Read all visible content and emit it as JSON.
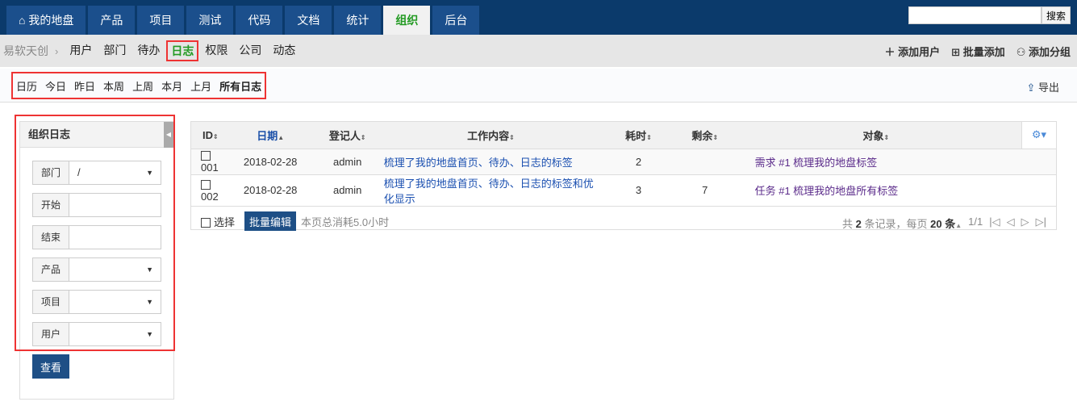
{
  "nav": {
    "tabs": [
      "我的地盘",
      "产品",
      "项目",
      "测试",
      "代码",
      "文档",
      "统计",
      "组织",
      "后台"
    ],
    "active": 7,
    "search_button": "搜索",
    "search_value": ""
  },
  "subnav": {
    "company": "易软天创",
    "items": [
      "用户",
      "部门",
      "待办",
      "日志",
      "权限",
      "公司",
      "动态"
    ],
    "active": 3,
    "actions": [
      "添加用户",
      "批量添加",
      "添加分组"
    ]
  },
  "toolbar": {
    "periods": [
      "日历",
      "今日",
      "昨日",
      "本周",
      "上周",
      "本月",
      "上月",
      "所有日志"
    ],
    "export": "导出"
  },
  "sidebar": {
    "title": "组织日志",
    "filters": [
      {
        "label": "部门",
        "value": "/",
        "select": true
      },
      {
        "label": "开始",
        "value": "",
        "select": false
      },
      {
        "label": "结束",
        "value": "",
        "select": false
      },
      {
        "label": "产品",
        "value": "",
        "select": true
      },
      {
        "label": "项目",
        "value": "",
        "select": true
      },
      {
        "label": "用户",
        "value": "",
        "select": true
      }
    ],
    "submit": "查看"
  },
  "table": {
    "columns": [
      "ID",
      "日期",
      "登记人",
      "工作内容",
      "耗时",
      "剩余",
      "对象"
    ],
    "rows": [
      {
        "id": "001",
        "date": "2018-02-28",
        "user": "admin",
        "work": "梳理了我的地盘首页、待办、日志的标签",
        "consumed": "2",
        "left": "",
        "object": "需求 #1 梳理我的地盘标签"
      },
      {
        "id": "002",
        "date": "2018-02-28",
        "user": "admin",
        "work": "梳理了我的地盘首页、待办、日志的标签和优化显示",
        "consumed": "3",
        "left": "7",
        "object": "任务 #1 梳理我的地盘所有标签"
      }
    ]
  },
  "footer": {
    "select": "选择",
    "batch_edit": "批量编辑",
    "summary": "本页总消耗5.0小时",
    "total_prefix": "共",
    "total": "2",
    "total_suffix": "条记录，每页",
    "per_page": "20",
    "per_suffix": "条",
    "page": "1/1"
  },
  "colors": {
    "nav_bg": "#0b3a6b",
    "tab_bg": "#1b4f8c",
    "active_green": "#229a22",
    "highlight_red": "#e33333"
  }
}
